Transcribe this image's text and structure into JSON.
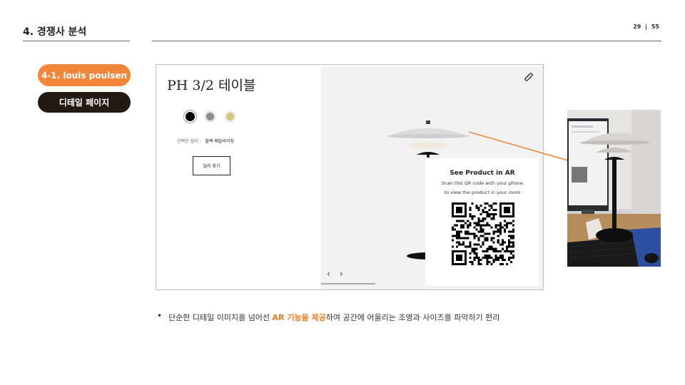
{
  "header": {
    "section_title": "4. 경쟁사 분석",
    "page_current": "29",
    "page_sep": "|",
    "page_total": "55"
  },
  "pills": {
    "brand": "4-1. louis poulsen",
    "detail": "디테일 페이지"
  },
  "product_page": {
    "title": "PH 3/2 테이블",
    "swatches": [
      {
        "name": "black",
        "color": "#000000"
      },
      {
        "name": "grey",
        "color": "#8a8a8a"
      },
      {
        "name": "gold",
        "color": "#d6c27a"
      }
    ],
    "selected_color_label": "선택한 컬러 :",
    "selected_color_value": "블랙 메탈라이징",
    "find_dealer_button": "딜러 찾기",
    "nav_prev": "‹",
    "nav_next": "›",
    "ar_card": {
      "title": "See Product in AR",
      "line1": "Scan this QR code with your phone",
      "line2": "to view the product in your room"
    }
  },
  "accent_color": "#f2873b",
  "bullet": {
    "before": "단순한 디테일 이미지를 넘어선 ",
    "highlight": "AR 기능을 제공",
    "after": "하여 공간에 어울리는 조명과 사이즈를 파악하기 편리"
  }
}
